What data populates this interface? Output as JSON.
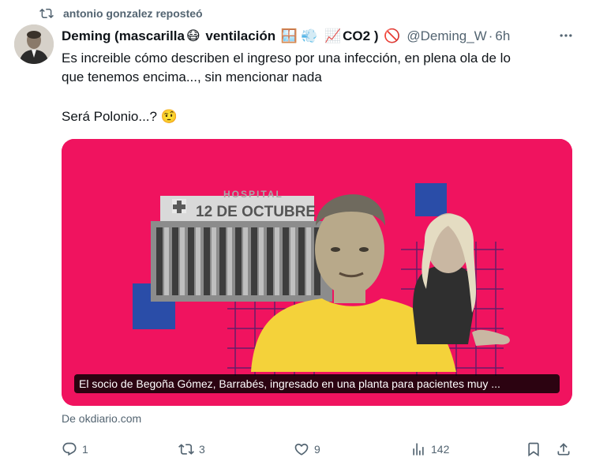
{
  "repost": {
    "text": "antonio gonzalez reposteó"
  },
  "author": {
    "name_part1": "Deming (mascarilla",
    "name_part2": " ventilación ",
    "name_part3": "CO2 )",
    "emoji_mask": "😷",
    "emoji_window": "🪟",
    "emoji_wind": "💨",
    "emoji_chart": "📈",
    "emoji_no": "🚫",
    "handle": "@Deming_W",
    "separator": "·",
    "time": "6h"
  },
  "post": {
    "line1": "Es increible cómo describen el ingreso por una infección, en plena ola de lo",
    "line2": "que tenemos encima..., sin mencionar nada",
    "line3": "Será Polonio...?",
    "emoji_think": "🤨"
  },
  "card": {
    "hospital_sign_top": "HOSPITAL",
    "hospital_sign_main": "12 DE OCTUBRE",
    "caption": "El socio de Begoña Gómez, Barrabés, ingresado en una planta para pacientes muy ...",
    "background_color": "#f0135f",
    "accent_blue": "#2a4da8",
    "accent_yellow": "#f4d23a"
  },
  "source": {
    "text": "De okdiario.com"
  },
  "actions": {
    "reply_count": "1",
    "repost_count": "3",
    "like_count": "9",
    "views_count": "142"
  },
  "icons": [
    "repost-icon",
    "more-icon",
    "reply-icon",
    "retweet-icon",
    "like-icon",
    "views-icon",
    "bookmark-icon",
    "share-icon"
  ]
}
